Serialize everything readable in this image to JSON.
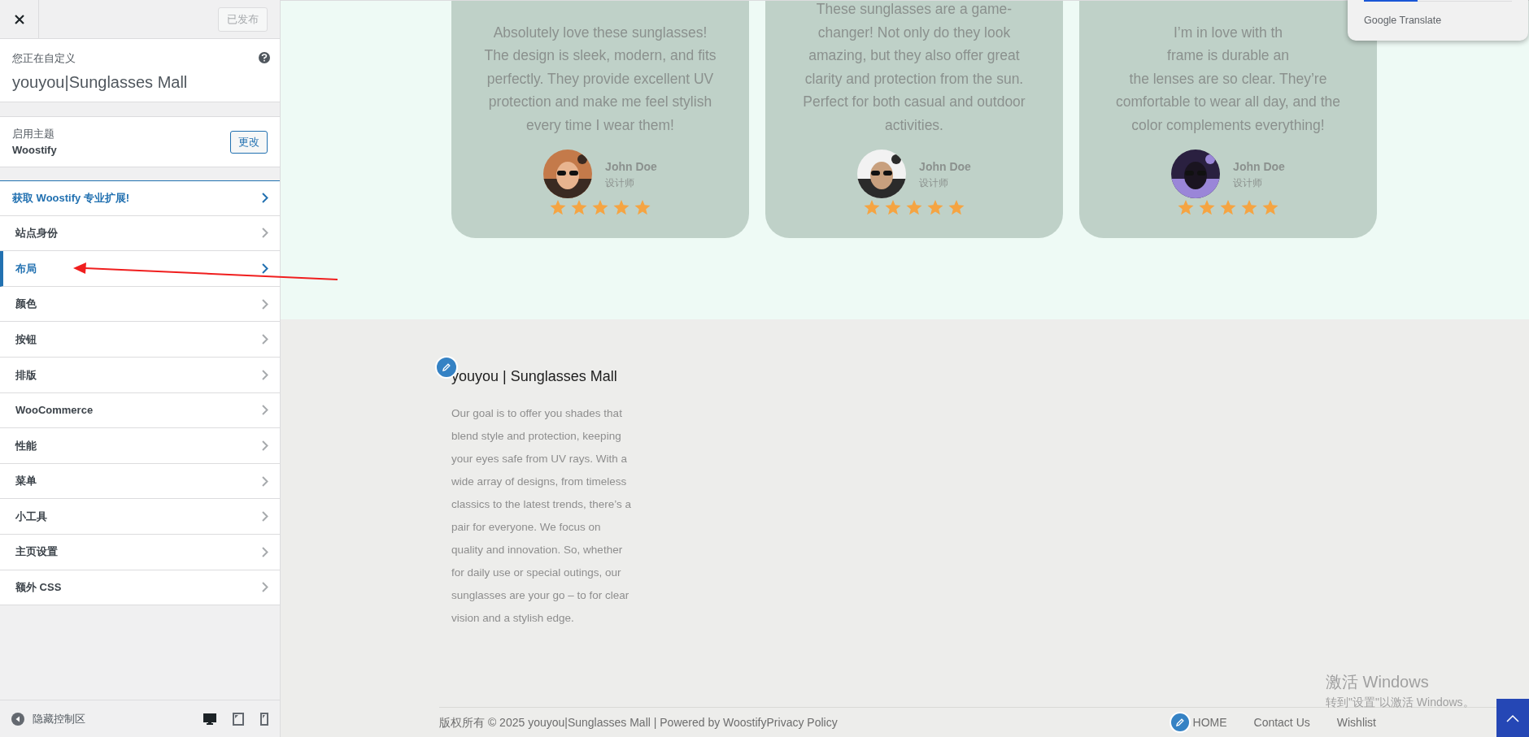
{
  "sidebar": {
    "publish_button": {
      "label": "已发布",
      "disabled": true
    },
    "customizing": {
      "label": "您正在自定义",
      "site": "youyou|Sunglasses Mall"
    },
    "theme": {
      "label": "启用主题",
      "name": "Woostify",
      "button": "更改"
    },
    "items": [
      {
        "label": "获取 Woostify 专业扩展!",
        "kind": "promo",
        "selected": false
      },
      {
        "label": "站点身份",
        "kind": "section",
        "selected": false
      },
      {
        "label": "布局",
        "kind": "section",
        "selected": true
      },
      {
        "label": "颜色",
        "kind": "section",
        "selected": false
      },
      {
        "label": "按钮",
        "kind": "section",
        "selected": false
      },
      {
        "label": "排版",
        "kind": "section",
        "selected": false
      },
      {
        "label": "WooCommerce",
        "kind": "section",
        "selected": false
      },
      {
        "label": "性能",
        "kind": "section",
        "selected": false
      },
      {
        "label": "菜单",
        "kind": "section",
        "selected": false
      },
      {
        "label": "小工具",
        "kind": "section",
        "selected": false
      },
      {
        "label": "主页设置",
        "kind": "section",
        "selected": false
      },
      {
        "label": "额外 CSS",
        "kind": "section",
        "selected": false
      }
    ],
    "bottom": {
      "hide_label": "隐藏控制区",
      "devices": [
        {
          "kind": "desktop",
          "selected": true
        },
        {
          "kind": "tablet",
          "selected": false
        },
        {
          "kind": "mobile",
          "selected": false
        }
      ]
    }
  },
  "preview": {
    "testimonials": [
      {
        "lines": [
          "Absolutely love these sunglasses!",
          "The design is sleek, modern, and fits",
          "perfectly. They provide excellent UV",
          "protection and make me feel stylish",
          "every time I wear them!"
        ],
        "name": "John Doe",
        "role": "设计师",
        "stars": 5
      },
      {
        "lines": [
          "These sunglasses are a game-",
          "changer! Not only do they look",
          "amazing, but they also offer great",
          "clarity and protection from the sun.",
          "Perfect for both casual and outdoor",
          "activities."
        ],
        "name": "John Doe",
        "role": "设计师",
        "stars": 5
      },
      {
        "lines": [
          "I’m in love with th",
          "frame is durable an",
          "the lenses are so clear. They’re",
          "comfortable to wear all day, and the",
          "color complements everything!"
        ],
        "name": "John Doe",
        "role": "设计师",
        "stars": 5
      }
    ],
    "translate_popup": {
      "label": "Google Translate"
    },
    "footer": {
      "title": "youyou | Sunglasses Mall",
      "text_lines": [
        "Our goal is to offer you shades that",
        "blend style and protection, keeping",
        "your eyes safe from UV rays. With a",
        "wide array of designs, from timeless",
        "classics to the latest trends, there’s a",
        "pair for everyone. We focus on",
        "quality and innovation. So, whether",
        "for daily use or special outings, our",
        "sunglasses are your go – to for clear",
        "vision and a stylish edge."
      ],
      "copyright": "版权所有 © 2025 youyou|Sunglasses Mall | Powered by Woostify",
      "policy_link": "Privacy Policy",
      "nav": [
        "HOME",
        "Contact Us",
        "Wishlist"
      ]
    },
    "os_notice": {
      "title": "激活 Windows",
      "text": "转到\"设置\"以激活 Windows。"
    }
  }
}
